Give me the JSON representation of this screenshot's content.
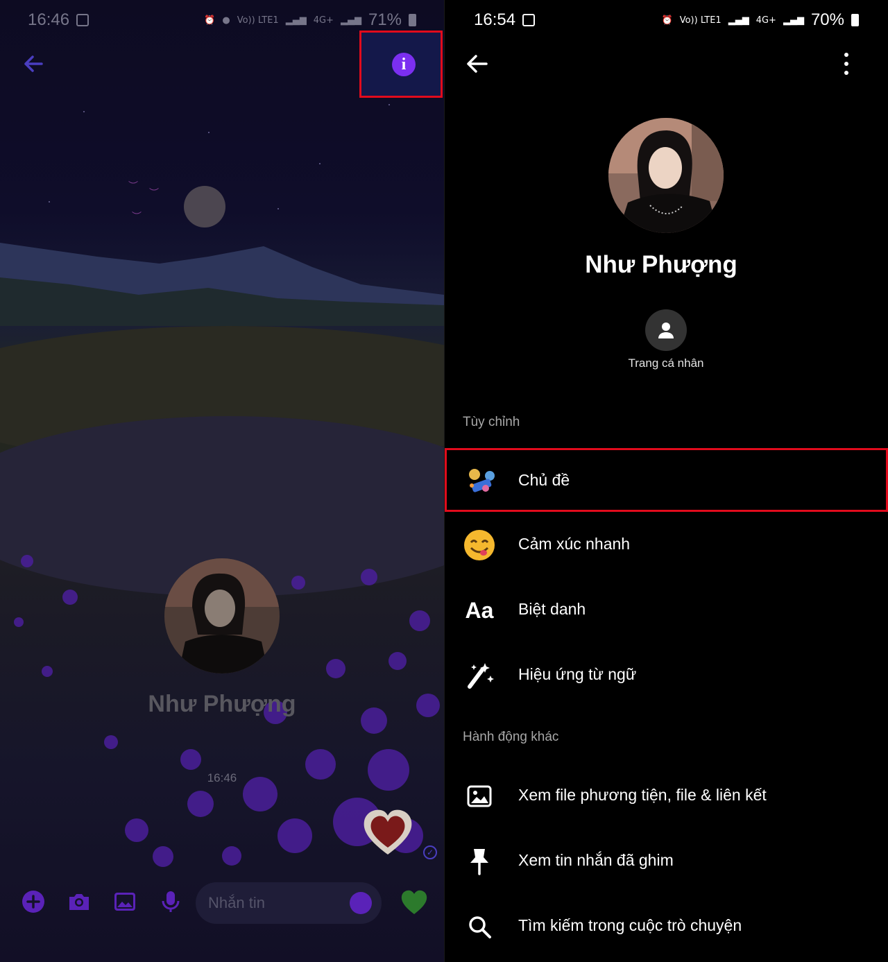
{
  "left_screen": {
    "status_bar": {
      "time": "16:46",
      "battery": "71%",
      "net": "4G+"
    },
    "contact_name": "Như Phượng",
    "message_time": "16:46",
    "composer": {
      "placeholder": "Nhắn tin"
    },
    "icons": {
      "back": "arrow-left-icon",
      "info": "info-icon",
      "add": "plus-circle-icon",
      "camera": "camera-icon",
      "gallery": "image-icon",
      "mic": "microphone-icon",
      "emoji": "emoji-icon",
      "like": "green-heart-icon"
    },
    "colors": {
      "accent": "#7b2ff0",
      "highlight_border": "#e10b1c"
    }
  },
  "right_screen": {
    "status_bar": {
      "time": "16:54",
      "battery": "70%",
      "net": "4G+"
    },
    "contact_name": "Như Phượng",
    "profile_button_label": "Trang cá nhân",
    "sections": {
      "customize_title": "Tùy chỉnh",
      "more_actions_title": "Hành động khác"
    },
    "customize_items": [
      {
        "label": "Chủ đề",
        "icon": "theme-icon"
      },
      {
        "label": "Cảm xúc nhanh",
        "icon": "emoji-reaction-icon"
      },
      {
        "label": "Biệt danh",
        "icon": "text-aa-icon",
        "glyph": "Aa"
      },
      {
        "label": "Hiệu ứng từ ngữ",
        "icon": "magic-wand-icon"
      }
    ],
    "action_items": [
      {
        "label": "Xem file phương tiện, file & liên kết",
        "icon": "image-icon"
      },
      {
        "label": "Xem tin nhắn đã ghim",
        "icon": "pin-icon"
      },
      {
        "label": "Tìm kiếm trong cuộc trò chuyện",
        "icon": "search-icon"
      }
    ],
    "colors": {
      "background": "#000000",
      "highlight_border": "#e10b1c"
    }
  }
}
